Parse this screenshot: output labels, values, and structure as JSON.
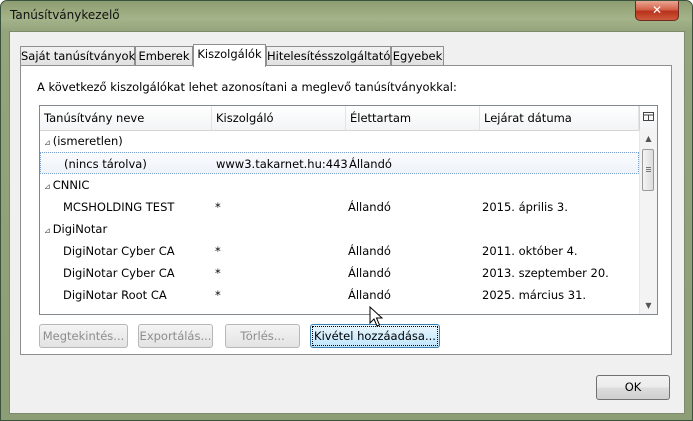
{
  "window": {
    "title": "Tanúsítványkezelő",
    "close_glyph": "✕"
  },
  "tabs": [
    {
      "label": "Saját tanúsítványok"
    },
    {
      "label": "Emberek"
    },
    {
      "label": "Kiszolgálók"
    },
    {
      "label": "Hitelesítésszolgáltatók"
    },
    {
      "label": "Egyebek"
    }
  ],
  "active_tab": "Kiszolgálók",
  "description": "A következő kiszolgálókat lehet azonosítani a meglevő tanúsítványokkal:",
  "table": {
    "columns": [
      "Tanúsítvány neve",
      "Kiszolgáló",
      "Élettartam",
      "Lejárat dátuma"
    ],
    "rows": [
      {
        "type": "group",
        "name": "(ismeretlen)"
      },
      {
        "type": "item",
        "name": "(nincs tárolva)",
        "server": "www3.takarnet.hu:443",
        "lifetime": "Állandó",
        "expiry": "",
        "selected": true
      },
      {
        "type": "group",
        "name": "CNNIC"
      },
      {
        "type": "item",
        "name": "MCSHOLDING TEST",
        "server": "*",
        "lifetime": "Állandó",
        "expiry": "2015. április 3."
      },
      {
        "type": "group",
        "name": "DigiNotar"
      },
      {
        "type": "item",
        "name": "DigiNotar Cyber CA",
        "server": "*",
        "lifetime": "Állandó",
        "expiry": "2011. október 4."
      },
      {
        "type": "item",
        "name": "DigiNotar Cyber CA",
        "server": "*",
        "lifetime": "Állandó",
        "expiry": "2013. szeptember 20."
      },
      {
        "type": "item",
        "name": "DigiNotar Root CA",
        "server": "*",
        "lifetime": "Állandó",
        "expiry": "2025. március 31."
      }
    ],
    "group_twisty": "⊿",
    "column_picker_icon": "column-picker-icon"
  },
  "buttons": {
    "view": "Megtekintés...",
    "export": "Exportálás...",
    "delete": "Törlés...",
    "add_exception": "Kivétel hozzáadása...",
    "ok": "OK"
  },
  "colors": {
    "frame": "#94a47c",
    "close": "#c8452b",
    "selection": "#7da2ce",
    "focus_button": "#bee6fd"
  }
}
